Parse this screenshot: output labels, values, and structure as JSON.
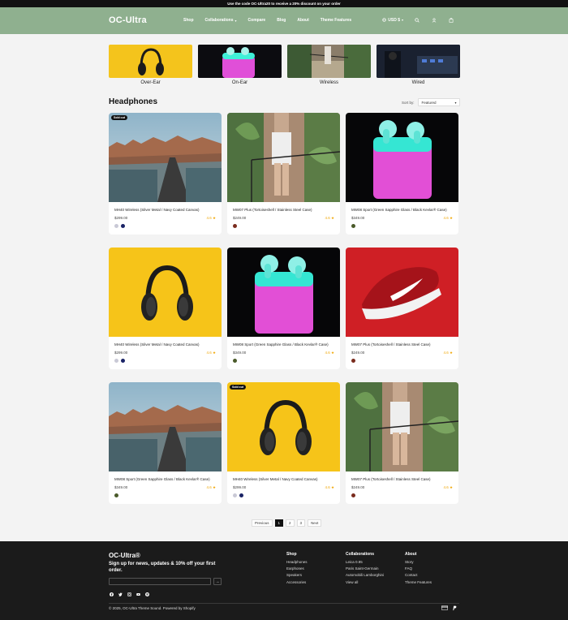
{
  "announcement": "Use the code OC-Ultra20 to receive a 20% discount on your order",
  "header": {
    "logo": "OC-Ultra",
    "nav": [
      {
        "label": "Shop"
      },
      {
        "label": "Collaborations",
        "has_dropdown": true
      },
      {
        "label": "Compare"
      },
      {
        "label": "Blog"
      },
      {
        "label": "About"
      },
      {
        "label": "Theme Features"
      }
    ],
    "currency": "USD $",
    "icons": [
      "search-icon",
      "account-icon",
      "cart-icon"
    ],
    "color": "#8fb08f"
  },
  "categories": [
    {
      "label": "Over-Ear",
      "image": "yellow-headphones"
    },
    {
      "label": "On-Ear",
      "image": "pink-earbuds"
    },
    {
      "label": "Wireless",
      "image": "plants-stairs"
    },
    {
      "label": "Wired",
      "image": "studio-gear"
    }
  ],
  "collection": {
    "title": "Headphones",
    "sort_label": "Sort by:",
    "sort_value": "Featured"
  },
  "products": [
    {
      "title": "MH40 Wireless (Silver Metal / Navy Coated Canvas)",
      "price": "$299.00",
      "rating": "4.6",
      "badge": "Sold out",
      "image": "city",
      "swatches": [
        "#c9c9d6",
        "#1a2366"
      ]
    },
    {
      "title": "MW07 Plus (Tortoiseshell / Stainless Steel Case)",
      "price": "$249.00",
      "rating": "4.6",
      "badge": "",
      "image": "plants",
      "swatches": [
        "#7a2c1e"
      ]
    },
    {
      "title": "MW08 Sport (Green Sapphire Glass / Black Kevlar® Case)",
      "price": "$349.00",
      "rating": "4.6",
      "badge": "",
      "image": "earbuds",
      "swatches": [
        "#4a5a2a"
      ]
    },
    {
      "title": "MH40 Wireless (Silver Metal / Navy Coated Canvas)",
      "price": "$299.00",
      "rating": "4.6",
      "badge": "",
      "image": "headphones",
      "swatches": [
        "#c9c9d6",
        "#1a2366"
      ]
    },
    {
      "title": "MW08 Sport (Green Sapphire Glass / Black Kevlar® Case)",
      "price": "$349.00",
      "rating": "4.6",
      "badge": "",
      "image": "earbuds",
      "swatches": [
        "#4a5a2a"
      ]
    },
    {
      "title": "MW07 Plus (Tortoiseshell / Stainless Steel Case)",
      "price": "$249.00",
      "rating": "4.6",
      "badge": "",
      "image": "sneaker",
      "swatches": [
        "#7a2c1e"
      ]
    },
    {
      "title": "MW08 Sport (Green Sapphire Glass / Black Kevlar® Case)",
      "price": "$349.00",
      "rating": "4.6",
      "badge": "",
      "image": "city",
      "swatches": [
        "#4a5a2a"
      ]
    },
    {
      "title": "MH40 Wireless (Silver Metal / Navy Coated Canvas)",
      "price": "$299.00",
      "rating": "4.6",
      "badge": "Sold out",
      "image": "headphones",
      "swatches": [
        "#c9c9d6",
        "#1a2366"
      ]
    },
    {
      "title": "MW07 Plus (Tortoiseshell / Stainless Steel Case)",
      "price": "$249.00",
      "rating": "4.6",
      "badge": "",
      "image": "plants",
      "swatches": [
        "#7a2c1e"
      ]
    }
  ],
  "pagination": {
    "previous": "Previous",
    "pages": [
      "1",
      "2",
      "3"
    ],
    "current": "1",
    "next": "Next"
  },
  "footer": {
    "logo": "OC-Ultra®",
    "tagline": "Sign up for news, updates & 10% off your first order.",
    "submit_icon": "arrow-right-icon",
    "socials": [
      "facebook-icon",
      "twitter-icon",
      "instagram-icon",
      "youtube-icon",
      "pinterest-icon"
    ],
    "columns": [
      {
        "title": "Shop",
        "items": [
          "Headphones",
          "Earphones",
          "Speakers",
          "Accessories"
        ]
      },
      {
        "title": "Collaborations",
        "items": [
          "Leica 0.95",
          "Paris Saint-Germain",
          "Automobili Lamborghini",
          "View all"
        ]
      },
      {
        "title": "About",
        "items": [
          "Story",
          "FAQ",
          "Contact",
          "Theme Features"
        ]
      }
    ],
    "copyright": "© 2025, OC-Ultra Theme Sound. Powered by Shopify",
    "payments": [
      "credit-card-icon",
      "paypal-icon"
    ]
  }
}
